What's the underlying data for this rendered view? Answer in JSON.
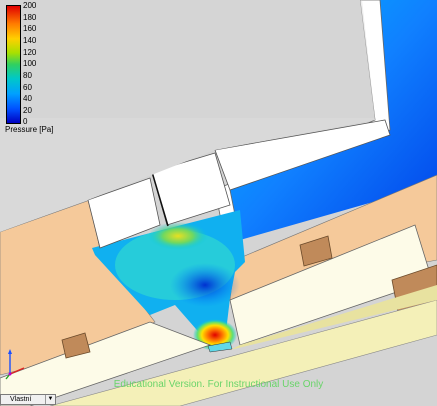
{
  "legend": {
    "ticks": [
      "200",
      "180",
      "160",
      "140",
      "120",
      "100",
      "80",
      "60",
      "40",
      "20",
      "0"
    ],
    "unit": "Pressure [Pa]"
  },
  "watermark": "Educational Version. For Instructional Use Only",
  "view_selector": {
    "value": "Vlastní",
    "arrow_icon": "chevron-down-icon"
  },
  "colors": {
    "pressure_max": "#e00000",
    "pressure_mid": "#30d060",
    "pressure_min": "#0000c0",
    "solid_wall": "#ffffff",
    "solid_tan": "#f5c99a",
    "solid_yellow": "#f5f2c0"
  }
}
